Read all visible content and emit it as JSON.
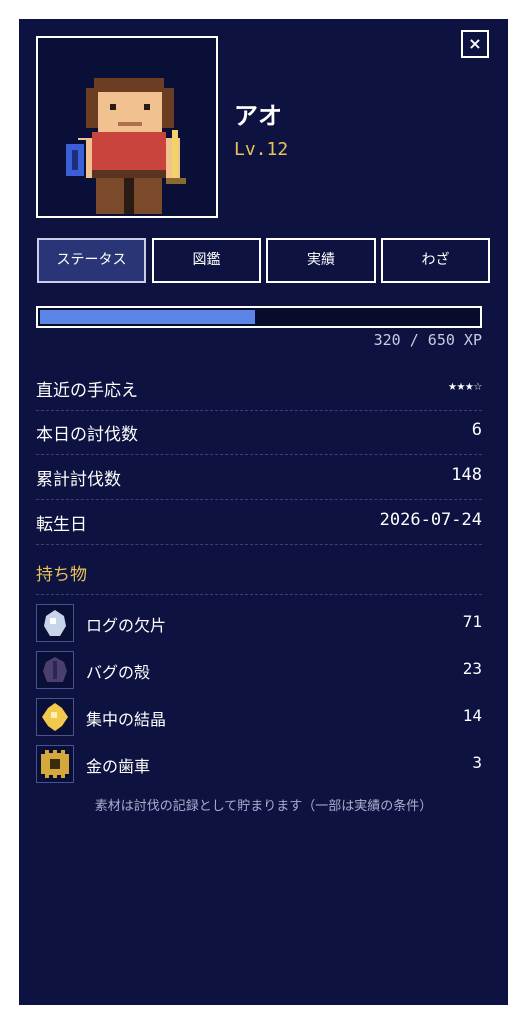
{
  "character": {
    "name": "アオ",
    "level": "Lv.12"
  },
  "tabs": [
    {
      "label": "ステータス",
      "active": true
    },
    {
      "label": "図鑑",
      "active": false
    },
    {
      "label": "実績",
      "active": false
    },
    {
      "label": "わざ",
      "active": false
    }
  ],
  "xp": {
    "current": 320,
    "max": 650,
    "text": "320 / 650 XP",
    "fill_fraction": 0.492
  },
  "stats": [
    {
      "label": "直近の手応え",
      "value": "★★★☆"
    },
    {
      "label": "本日の討伐数",
      "value": "6"
    },
    {
      "label": "累計討伐数",
      "value": "148"
    },
    {
      "label": "転生日",
      "value": "2026-07-24"
    }
  ],
  "inventory": {
    "title": "持ち物",
    "items": [
      {
        "name": "ログの欠片",
        "count": "71",
        "icon": "log-shard-icon",
        "color": "#c8d4ea"
      },
      {
        "name": "バグの殻",
        "count": "23",
        "icon": "bug-shell-icon",
        "color": "#4a3f6e"
      },
      {
        "name": "集中の結晶",
        "count": "14",
        "icon": "focus-crystal-icon",
        "color": "#f2c94c"
      },
      {
        "name": "金の歯車",
        "count": "3",
        "icon": "gold-gear-icon",
        "color": "#d4a83a"
      }
    ]
  },
  "note": "素材は討伐の記録として貯まります（一部は実績の条件）",
  "close_label": "×",
  "colors": {
    "panel_bg": "#0d1240",
    "accent_gold": "#e8c25a",
    "xp_fill": "#5b86e8"
  }
}
